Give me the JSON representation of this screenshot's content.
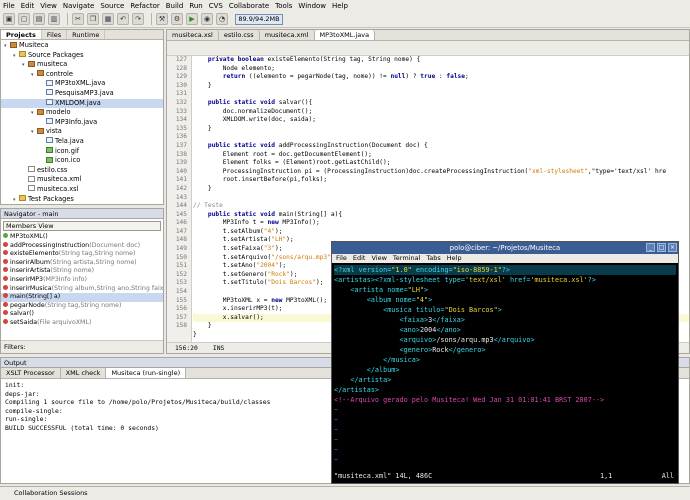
{
  "menubar": [
    "File",
    "Edit",
    "View",
    "Navigate",
    "Source",
    "Refactor",
    "Build",
    "Run",
    "CVS",
    "Collaborate",
    "Tools",
    "Window",
    "Help"
  ],
  "memory": "89.9/94.2MB",
  "projects": {
    "tabs": [
      "Projects",
      "Files",
      "Runtime"
    ],
    "tree": [
      {
        "label": "Musiteca",
        "indent": 0,
        "icon": "project-icon"
      },
      {
        "label": "Source Packages",
        "indent": 1,
        "icon": "folder-icon"
      },
      {
        "label": "musiteca",
        "indent": 2,
        "icon": "package-icon"
      },
      {
        "label": "controle",
        "indent": 3,
        "icon": "package-icon"
      },
      {
        "label": "MP3toXML.java",
        "indent": 4,
        "icon": "java-file-icon"
      },
      {
        "label": "PesquisaMP3.java",
        "indent": 4,
        "icon": "java-file-icon"
      },
      {
        "label": "XMLDOM.java",
        "indent": 4,
        "icon": "java-file-icon",
        "selected": true
      },
      {
        "label": "modelo",
        "indent": 3,
        "icon": "package-icon"
      },
      {
        "label": "MP3Info.java",
        "indent": 4,
        "icon": "java-file-icon"
      },
      {
        "label": "vista",
        "indent": 3,
        "icon": "package-icon"
      },
      {
        "label": "Tela.java",
        "indent": 4,
        "icon": "java-file-icon"
      },
      {
        "label": "icon.gif",
        "indent": 4,
        "icon": "image-file-icon"
      },
      {
        "label": "icon.ico",
        "indent": 4,
        "icon": "image-file-icon"
      },
      {
        "label": "estilo.css",
        "indent": 2,
        "icon": "file-icon"
      },
      {
        "label": "musiteca.xml",
        "indent": 2,
        "icon": "file-icon"
      },
      {
        "label": "musiteca.xsl",
        "indent": 2,
        "icon": "file-icon"
      },
      {
        "label": "Test Packages",
        "indent": 1,
        "icon": "folder-icon"
      }
    ]
  },
  "navigator": {
    "title": "Navigator - main",
    "view": "Members View",
    "items": [
      {
        "name": "MP3toXML()",
        "sig": "",
        "icon": "constructor-icon"
      },
      {
        "name": "addProcessingInstruction",
        "sig": "(Document doc)",
        "icon": "method-icon"
      },
      {
        "name": "existeElemento",
        "sig": "(String tag,String nome)",
        "icon": "method-icon"
      },
      {
        "name": "inserirAlbum",
        "sig": "(String artista,String nome)",
        "icon": "method-icon"
      },
      {
        "name": "inserirArtista",
        "sig": "(String nome)",
        "icon": "method-icon"
      },
      {
        "name": "inserirMP3",
        "sig": "(MP3Info info)",
        "icon": "method-icon"
      },
      {
        "name": "inserirMusica",
        "sig": "(String album,String ano,String faix",
        "icon": "method-icon"
      },
      {
        "name": "main(String[] a)",
        "sig": "",
        "icon": "method-icon",
        "selected": true
      },
      {
        "name": "pegarNode",
        "sig": "(String tag,String nome)",
        "icon": "method-icon"
      },
      {
        "name": "salvar()",
        "sig": "",
        "icon": "method-icon"
      },
      {
        "name": "setSaida",
        "sig": "(File arquivoXML)",
        "icon": "method-icon"
      }
    ],
    "filters_label": "Filters:"
  },
  "editor": {
    "tabs": [
      "musiteca.xsl",
      "estilo.css",
      "musiteca.xml",
      "MP3toXML.java"
    ],
    "active_tab": 3,
    "line_numbers": [
      "127",
      "128",
      "129",
      "130",
      "131",
      "132",
      "133",
      "134",
      "135",
      "136",
      "137",
      "138",
      "139",
      "140",
      "141",
      "142",
      "143",
      "144",
      "145",
      "146",
      "147",
      "148",
      "149",
      "150",
      "151",
      "152",
      "153",
      "154",
      "155",
      "156",
      "157",
      "158"
    ],
    "code": [
      "    private boolean existeElemento(String tag, String nome) {",
      "        Node elemento;",
      "        return ((elemento = pegarNode(tag, nome)) != null) ? true : false;",
      "    }",
      "",
      "    public static void salvar(){",
      "        doc.normalizeDocument();",
      "        XMLDOM.write(doc, saida);",
      "    }",
      "",
      "    public static void addProcessingInstruction(Document doc) {",
      "        Element root = doc.getDocumentElement();",
      "        Element folks = (Element)root.getLastChild();",
      "        ProcessingInstruction pi = (ProcessingInstruction)doc.createProcessingInstruction(\"xml-stylesheet\",\"type='text/xsl' hre",
      "        root.insertBefore(pi,folks);",
      "    }",
      "",
      "// Teste",
      "    public static void main(String[] a){",
      "        MP3Info t = new MP3Info();",
      "        t.setAlbum(\"4\");",
      "        t.setArtista(\"LH\");",
      "        t.setFaixa(\"3\");",
      "        t.setArquivo(\"/sons/arqu.mp3\");",
      "        t.setAno(\"2004\");",
      "        t.setGenero(\"Rock\");",
      "        t.setTitulo(\"Dois Barcos\");",
      "",
      "        MP3toXML x = new MP3toXML();",
      "        x.inserirMP3(t);",
      "        x.salvar();",
      "    }",
      "}"
    ],
    "cursor": "156:20",
    "mode": "INS"
  },
  "output": {
    "title": "Output",
    "tabs": [
      "XSLT Processor",
      "XML check",
      "Musiteca (run-single)"
    ],
    "active_tab": 2,
    "lines": [
      "init:",
      "deps-jar:",
      "Compiling 1 source file to /home/polo/Projetos/Musiteca/build/classes",
      "compile-single:",
      "run-single:",
      "BUILD SUCCESSFUL (total time: 0 seconds)"
    ]
  },
  "bottom": "Collaboration Sessions",
  "terminal": {
    "title": "polo@ciber: ~/Projetos/Musiteca",
    "menu": [
      "File",
      "Edit",
      "View",
      "Terminal",
      "Tabs",
      "Help"
    ],
    "status_file": "\"musiteca.xml\" 14L, 486C",
    "status_pos": "1,1",
    "status_all": "All"
  }
}
